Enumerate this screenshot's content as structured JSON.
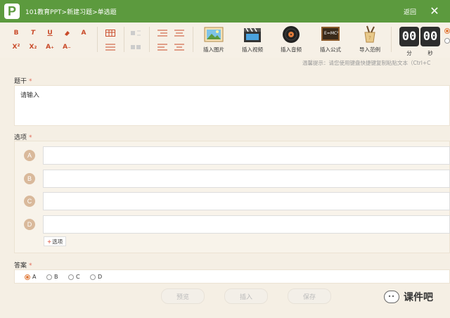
{
  "titlebar": {
    "logo_letter": "P",
    "breadcrumb": [
      "101教育PPT",
      "新建习题",
      "单选题"
    ],
    "separator": ">",
    "back_label": "返回",
    "close_glyph": "✕",
    "bg_color": "#5c9a3e"
  },
  "toolbar": {
    "format_buttons": [
      "B",
      "T",
      "U",
      "A",
      "X²",
      "X₂",
      "A₊",
      "A₋"
    ],
    "tools": [
      {
        "label": "插入图片",
        "icon": "picture-icon"
      },
      {
        "label": "插入视频",
        "icon": "clapperboard-icon"
      },
      {
        "label": "插入音频",
        "icon": "vinyl-record-icon"
      },
      {
        "label": "插入公式",
        "icon": "formula-board-icon",
        "icon_text": "E=MC²"
      },
      {
        "label": "导入范例",
        "icon": "brush-pot-icon"
      }
    ],
    "timer": {
      "minutes": "00",
      "seconds": "00",
      "min_label": "分",
      "sec_label": "秒"
    }
  },
  "hint": "温馨提示：请您使用键盘快捷键复制粘贴文本（Ctrl+C",
  "stem": {
    "label": "题干",
    "required_mark": "*",
    "placeholder": "请输入"
  },
  "options": {
    "label": "选项",
    "required_mark": "*",
    "items": [
      {
        "letter": "A"
      },
      {
        "letter": "B"
      },
      {
        "letter": "C"
      },
      {
        "letter": "D"
      }
    ],
    "add_label": "选项",
    "add_plus": "+"
  },
  "answer": {
    "label": "答案",
    "required_mark": "*",
    "choices": [
      "A",
      "B",
      "C",
      "D"
    ],
    "selected": "A"
  },
  "footer": {
    "preview_label": "预览",
    "insert_label": "插入",
    "save_label": "保存"
  },
  "watermark": "课件吧"
}
